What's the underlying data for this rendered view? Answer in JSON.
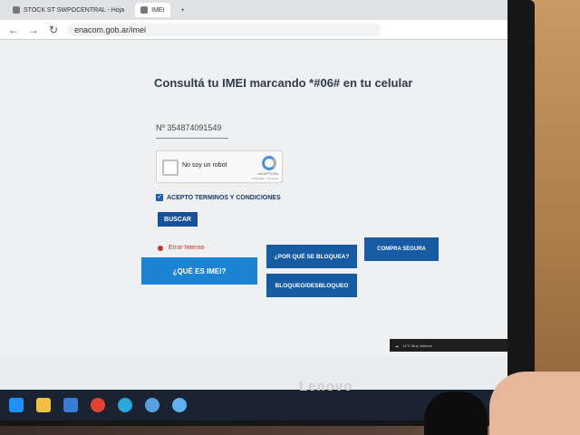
{
  "tabs": [
    {
      "label": "STOCK ST SWPOCENTRAL - Hoja",
      "active": false
    },
    {
      "label": "IMEI",
      "active": true
    }
  ],
  "address": {
    "url": "enacom.gob.ar/imei"
  },
  "page": {
    "title": "Consultá tu IMEI marcando *#06# en tu celular",
    "imei_prefix": "Nº",
    "imei_value": "354874091549",
    "captcha_label": "No soy un robot",
    "captcha_brand": "reCAPTCHA",
    "captcha_terms": "Privacidad - Términos",
    "terms_label": "ACEPTO TERMINOS Y CONDICIONES",
    "search_button": "BUSCAR",
    "error_text": "Error Interno",
    "buttons": {
      "que_es": "¿QUÉ ES IMEI?",
      "por_que": "¿POR QUÉ SE BLOQUEA?",
      "compra": "COMPRA SEGURA",
      "bloqueo": "BLOQUEO/DESBLOQUEO"
    }
  },
  "tray": {
    "weather": "14°C Muy nublado"
  },
  "monitor_brand": "Lenovo",
  "colors": {
    "primary": "#17509c",
    "accent": "#1c83d4",
    "error": "#c4322b"
  }
}
